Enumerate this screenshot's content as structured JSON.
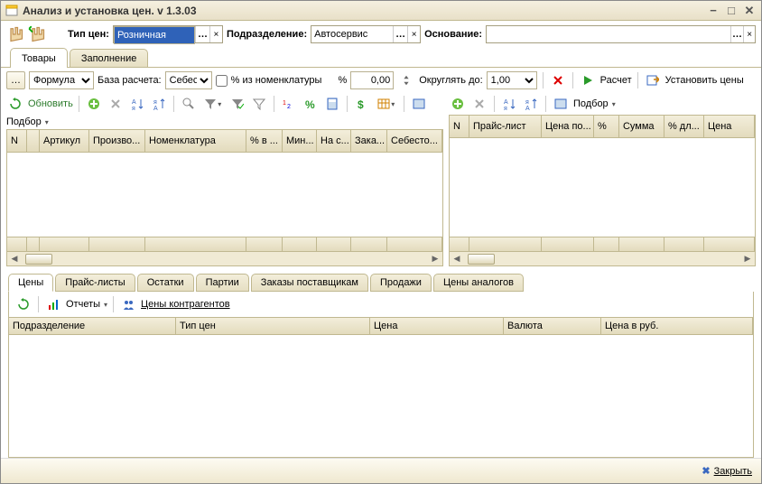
{
  "title": "Анализ и установка цен. v 1.3.03",
  "top": {
    "type_label": "Тип цен:",
    "type_value": "Розничная",
    "division_label": "Подразделение:",
    "division_value": "Автосервис",
    "basis_label": "Основание:",
    "basis_value": ""
  },
  "main_tabs": {
    "t0": "Товары",
    "t1": "Заполнение"
  },
  "bar1": {
    "formula": "Формула",
    "base_label": "База расчета:",
    "base_value": "Себес",
    "from_nom": "% из номенклатуры",
    "pct_label": "%",
    "pct_value": "0,00",
    "round_label": "Округлять до:",
    "round_value": "1,00",
    "calc": "Расчет",
    "set_prices": "Установить цены"
  },
  "left_toolbar": {
    "refresh": "Обновить",
    "select": "Подбор"
  },
  "right_toolbar": {
    "select": "Подбор"
  },
  "left_cols": {
    "n": "N",
    "art": "Артикул",
    "prod": "Произво...",
    "nom": "Номенклатура",
    "pctv": "% в ...",
    "min": "Мин...",
    "nas": "На с...",
    "zak": "Зака...",
    "seb": "Себесто..."
  },
  "right_cols": {
    "n": "N",
    "price": "Прайс-лист",
    "cenapo": "Цена по...",
    "pct": "%",
    "sum": "Сумма",
    "pctdl": "% дл...",
    "cena": "Цена"
  },
  "btabs": {
    "t0": "Цены",
    "t1": "Прайс-листы",
    "t2": "Остатки",
    "t3": "Партии",
    "t4": "Заказы поставщикам",
    "t5": "Продажи",
    "t6": "Цены аналогов"
  },
  "bbar": {
    "reports": "Отчеты",
    "contr": "Цены контрагентов"
  },
  "bcols": {
    "c0": "Подразделение",
    "c1": "Тип цен",
    "c2": "Цена",
    "c3": "Валюта",
    "c4": "Цена в руб."
  },
  "footer": {
    "close": "Закрыть"
  }
}
